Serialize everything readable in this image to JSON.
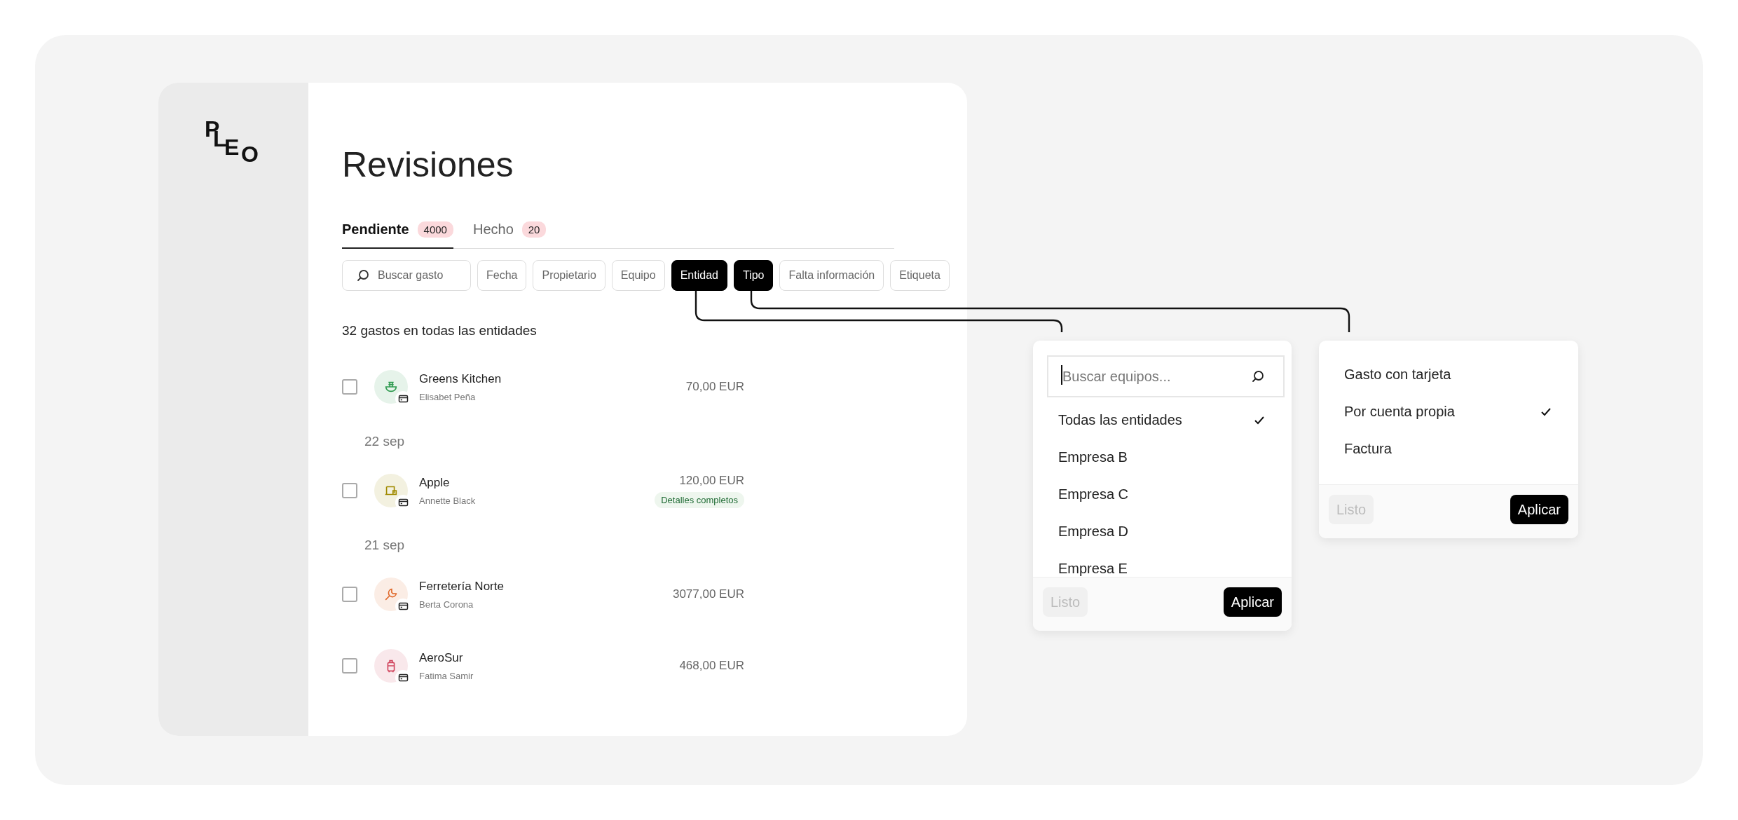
{
  "logo": "PLEO",
  "title": "Revisiones",
  "tabs": [
    {
      "label": "Pendiente",
      "count": "4000",
      "selected": true
    },
    {
      "label": "Hecho",
      "count": "20",
      "selected": false
    }
  ],
  "search": {
    "placeholder": "Buscar gasto"
  },
  "filters": [
    {
      "label": "Fecha",
      "selected": false
    },
    {
      "label": "Propietario",
      "selected": false
    },
    {
      "label": "Equipo",
      "selected": false
    },
    {
      "label": "Entidad",
      "selected": true
    },
    {
      "label": "Tipo",
      "selected": true
    },
    {
      "label": "Falta información",
      "selected": false
    },
    {
      "label": "Etiqueta",
      "selected": false
    }
  ],
  "summary": "32 gastos en todas las entidades",
  "groups": [
    {
      "rows": [
        {
          "merchant": "Greens Kitchen",
          "owner": "Elisabet Peña",
          "checked": false,
          "amount": "70,00 EUR",
          "kind": "bowl",
          "color": "#2e9a4f"
        }
      ]
    },
    {
      "date": "22 sep",
      "rows": [
        {
          "merchant": "Apple",
          "owner": "Annette Black",
          "checked": false,
          "amount": "120,00 EUR",
          "badge": "Detalles completos",
          "kind": "laptop",
          "color": "#a08a00"
        }
      ]
    },
    {
      "date": "21 sep",
      "rows": [
        {
          "merchant": "Ferretería Norte",
          "owner": "Berta Corona",
          "checked": false,
          "amount": "3077,00 EUR",
          "kind": "wrench",
          "color": "#e06a2c"
        },
        {
          "merchant": "AeroSur",
          "owner": "Fatima Samir",
          "checked": false,
          "amount": "468,00 EUR",
          "kind": "luggage",
          "color": "#d1455e"
        }
      ]
    }
  ],
  "dropdowns": [
    {
      "search_placeholder": "Buscar equipos...",
      "options": [
        {
          "label": "Todas las entidades",
          "checked": true
        },
        {
          "label": "Empresa B",
          "checked": false
        },
        {
          "label": "Empresa C",
          "checked": false
        },
        {
          "label": "Empresa D",
          "checked": false
        },
        {
          "label": "Empresa E",
          "checked": false
        }
      ],
      "buttons": [
        {
          "label": "Listo",
          "disabled": true
        },
        {
          "label": "Aplicar",
          "disabled": false
        }
      ]
    },
    {
      "options": [
        {
          "label": "Gasto con tarjeta",
          "checked": false
        },
        {
          "label": "Por cuenta propia",
          "checked": true
        },
        {
          "label": "Factura",
          "checked": false
        }
      ],
      "buttons": [
        {
          "label": "Listo",
          "disabled": true
        },
        {
          "label": "Aplicar",
          "disabled": false
        }
      ]
    }
  ]
}
